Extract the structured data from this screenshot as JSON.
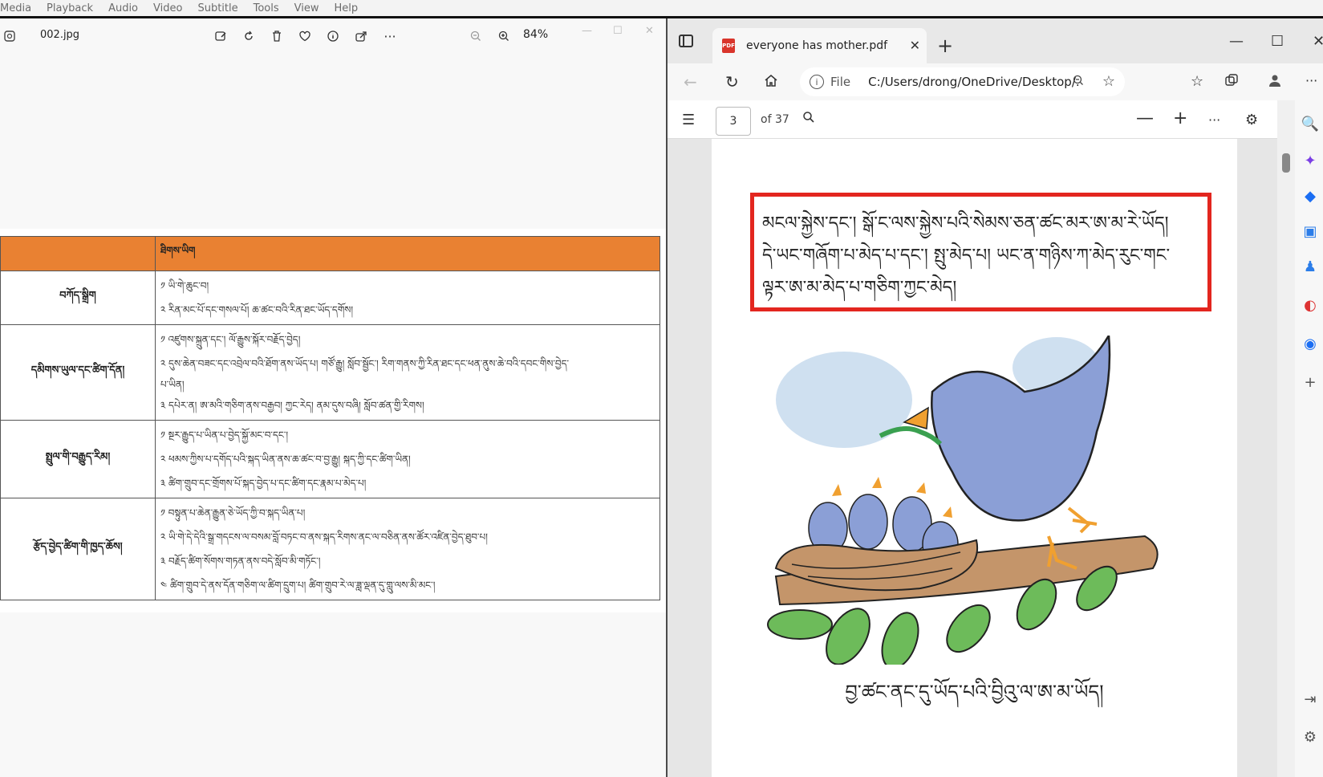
{
  "menubar": {
    "items": [
      "Media",
      "Playback",
      "Audio",
      "Video",
      "Subtitle",
      "Tools",
      "View",
      "Help"
    ]
  },
  "viewer": {
    "filename": "002.jpg",
    "zoom": "84%",
    "table": {
      "header": "ཐིགས་ཡིག",
      "rows": [
        {
          "category": "བཀོད་སྒྲིག",
          "lines": [
            "༡ ཡི་གེ་ཆུང་བ།",
            "༢ རིན་མང་པོ་དང་གསལ་པོ། ཆ་ཚང་བའི་རིན་ཐང་ཡོད་དགོས།"
          ]
        },
        {
          "category": "དམིགས་ཡུལ་དང་ཚིག་དོན།",
          "lines": [
            "༡ འཛུགས་སྐྲུན་དང་། ལོ་རྒྱུས་སྐོར་བརྗོད་བྱེད།",
            "༢ དུས་ཆེན་བཟང་དང་འབྲེལ་བའི་ཐོག་ནས་ཡོད་པ། གཙོ་རྒྱུ། སློབ་སྦྱོང་། རིག་གནས་ཀྱི་རིན་ཐང་དང་ཕན་ནུས་ཆེ་བའི་དབང་གིས་བྱེད་",
            "པ་ཡིན།",
            "༣ དཔེར་ན། ཨ་མའི་གཅིག་ནས་བརྒྱབ། ཀྱང་རེད། ནམ་དུས་བཞི། སློབ་ཚན་གྱི་རིགས།"
          ]
        },
        {
          "category": "སྤྲུལ་གི་བརྒྱུད་རིམ།",
          "lines": [
            "༡ སྔར་རྒྱུད་པ་ཡིན་པ་བྱེད་སྐྱོ་མང་བ་དང་།",
            "༢ ཕམས་ཀྱིས་པ་དགོད་པའི་སྐད་ཡིན་ནས་ཆ་ཚང་བ་བྱ་རྒྱུ། སྐད་ཀྱི་དང་ཚིག་ཡིན།",
            "༣ ཚིག་གྲུབ་དང་གྲོགས་པོ་སྐད་བྱེད་པ་དང་ཚིག་དང་རྣམ་པ་མེད་པ།"
          ]
        },
        {
          "category": "རྩོད་བྱེད་ཚིག་གི་ཁྱད་ཆོས།",
          "lines": [
            "༡ བསྟུན་པ་ཆེན་རྒྱུན་ཅེ་ཡོད་ཀྱི་བ་སྐད་ཡིན་པ།",
            "༢ ཡི་གེ་དེ་དེའི་སྒྲ་གདངས་ལ་བསམ་བློ་བཏང་བ་ནས་སྐད་རིགས་ནང་ལ་བཅིན་ནས་ཚོར་འཛིན་བྱེད་ཐུབ་པ།",
            "༣ བརྗོད་ཚིག་སོགས་གཏན་ནས་བདེ་སློབ་མི་གཏོང་།",
            "༤ ཚིག་གྲུབ་དེ་ནས་དོན་གཅིག་ལ་ཚིག་དྲུག་པ། ཚིག་གྲུབ་རེ་ལ་ཟླ་ལྡན་དུ་གླུ་ལས་མི་མང་།"
          ]
        }
      ]
    }
  },
  "browser": {
    "tab_title": "everyone has mother.pdf",
    "url_scheme": "File",
    "url_path": "C:/Users/drong/OneDrive/Desktop/...",
    "page_current": "3",
    "page_total": "of 37",
    "pdf": {
      "quote_lines": [
        "མངལ་སྐྱེས་དང་། སྒོ་ང་ལས་སྐྱེས་པའི་སེམས་ཅན་ཚང་མར་ཨ་མ་རེ་ཡོད།",
        "དེ་ཡང་གཞོག་པ་མེད་པ་དང་། སྤུ་མེད་པ། ཡང་ན་གཉིས་ཀ་མེད་རུང་གང་",
        "ལྟར་ཨ་མ་མེད་པ་གཅིག་ཀྱང་མེད།"
      ],
      "caption": "བྱ་ཚང་ནང་དུ་ཡོད་པའི་བྱིའུ་ལ་ཨ་མ་ཡོད།"
    }
  },
  "colors": {
    "table_header": "#e98132",
    "quote_border": "#e3261f",
    "bird": "#8b9fd6",
    "branch": "#c4956a",
    "leaf": "#6dbb5a",
    "cloud": "#cfe0f0"
  }
}
